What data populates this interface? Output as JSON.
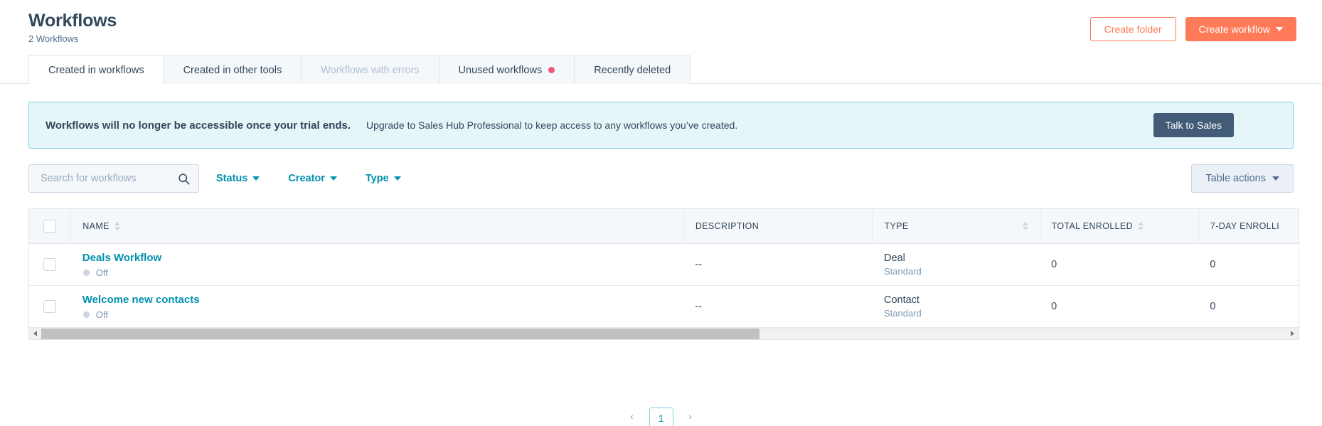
{
  "header": {
    "title": "Workflows",
    "subtitle": "2 Workflows",
    "create_folder_label": "Create folder",
    "create_workflow_label": "Create workflow"
  },
  "tabs": [
    {
      "label": "Created in workflows",
      "active": true,
      "disabled": false,
      "badge": false
    },
    {
      "label": "Created in other tools",
      "active": false,
      "disabled": false,
      "badge": false
    },
    {
      "label": "Workflows with errors",
      "active": false,
      "disabled": true,
      "badge": false
    },
    {
      "label": "Unused workflows",
      "active": false,
      "disabled": false,
      "badge": true
    },
    {
      "label": "Recently deleted",
      "active": false,
      "disabled": false,
      "badge": false
    }
  ],
  "banner": {
    "headline": "Workflows will no longer be accessible once your trial ends.",
    "body": "Upgrade to Sales Hub Professional to keep access to any workflows you’ve created.",
    "cta_label": "Talk to Sales",
    "accent_color": "#7fd1de",
    "background_color": "#e5f5f8"
  },
  "toolbar": {
    "search_placeholder": "Search for workflows",
    "search_value": "",
    "filters": [
      {
        "label": "Status"
      },
      {
        "label": "Creator"
      },
      {
        "label": "Type"
      }
    ],
    "table_actions_label": "Table actions"
  },
  "table": {
    "columns": [
      {
        "key": "name",
        "label": "NAME",
        "sortable": true
      },
      {
        "key": "description",
        "label": "DESCRIPTION",
        "sortable": false
      },
      {
        "key": "type",
        "label": "TYPE",
        "sortable": true
      },
      {
        "key": "total_enrolled",
        "label": "TOTAL ENROLLED",
        "sortable": true
      },
      {
        "key": "seven_day",
        "label": "7-DAY ENROLLI",
        "sortable": false
      }
    ],
    "rows": [
      {
        "name": "Deals Workflow",
        "status": "Off",
        "description": "--",
        "type": "Deal",
        "type_sub": "Standard",
        "total_enrolled": "0",
        "seven_day": "0"
      },
      {
        "name": "Welcome new contacts",
        "status": "Off",
        "description": "--",
        "type": "Contact",
        "type_sub": "Standard",
        "total_enrolled": "0",
        "seven_day": "0"
      }
    ]
  },
  "pagination": {
    "prev": "‹",
    "current_page": "1",
    "next": "›"
  },
  "colors": {
    "brand_orange": "#ff7a59",
    "link_teal": "#0091ae",
    "text_dark": "#33475b",
    "badge_pink": "#f2547d"
  }
}
